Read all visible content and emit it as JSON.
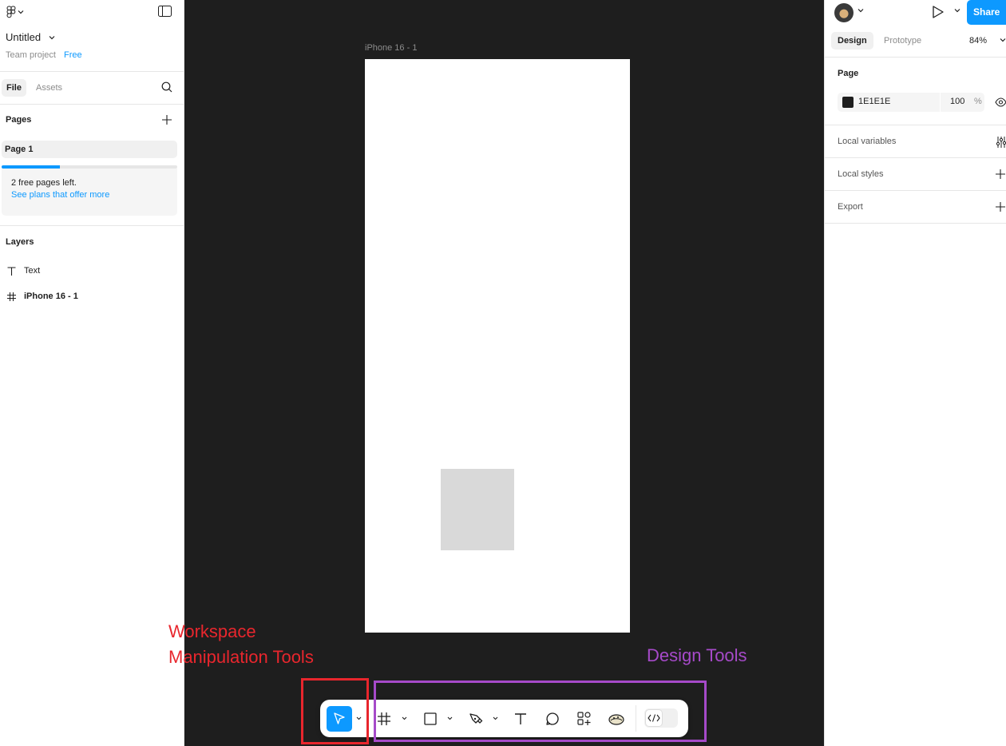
{
  "left_panel": {
    "file_title": "Untitled",
    "team": "Team project",
    "plan_badge": "Free",
    "tabs": [
      "File",
      "Assets"
    ],
    "pages_heading": "Pages",
    "pages": [
      "Page 1"
    ],
    "free_pages_progress": 0.33,
    "upsell_line1": "2 free pages left.",
    "upsell_link": "See plans that offer more",
    "layers_heading": "Layers",
    "layers": [
      {
        "name": "Text",
        "icon": "text-icon"
      },
      {
        "name": "iPhone 16 - 1",
        "icon": "frame-icon"
      }
    ]
  },
  "canvas": {
    "frame_label": "iPhone 16 - 1",
    "annotations": {
      "workspace_line1": "Workspace",
      "workspace_line2": "Manipulation Tools",
      "design": "Design Tools"
    },
    "toolbar_tools": [
      "move-tool",
      "frame-tool",
      "shape-tool",
      "pen-tool",
      "text-tool",
      "comment-tool",
      "actions-tool",
      "ui3-tool",
      "dev-mode-toggle"
    ],
    "help_label": "?"
  },
  "right_panel": {
    "share_label": "Share",
    "tabs": [
      "Design",
      "Prototype"
    ],
    "zoom": "84%",
    "page_section": "Page",
    "background_hex": "1E1E1E",
    "background_color": "#1e1e1e",
    "opacity": "100",
    "opacity_unit": "%",
    "local_variables": "Local variables",
    "local_styles": "Local styles",
    "export": "Export"
  },
  "colors": {
    "accent": "#0d99ff",
    "annotation_red": "#e8262d",
    "annotation_purple": "#a64ac9"
  }
}
